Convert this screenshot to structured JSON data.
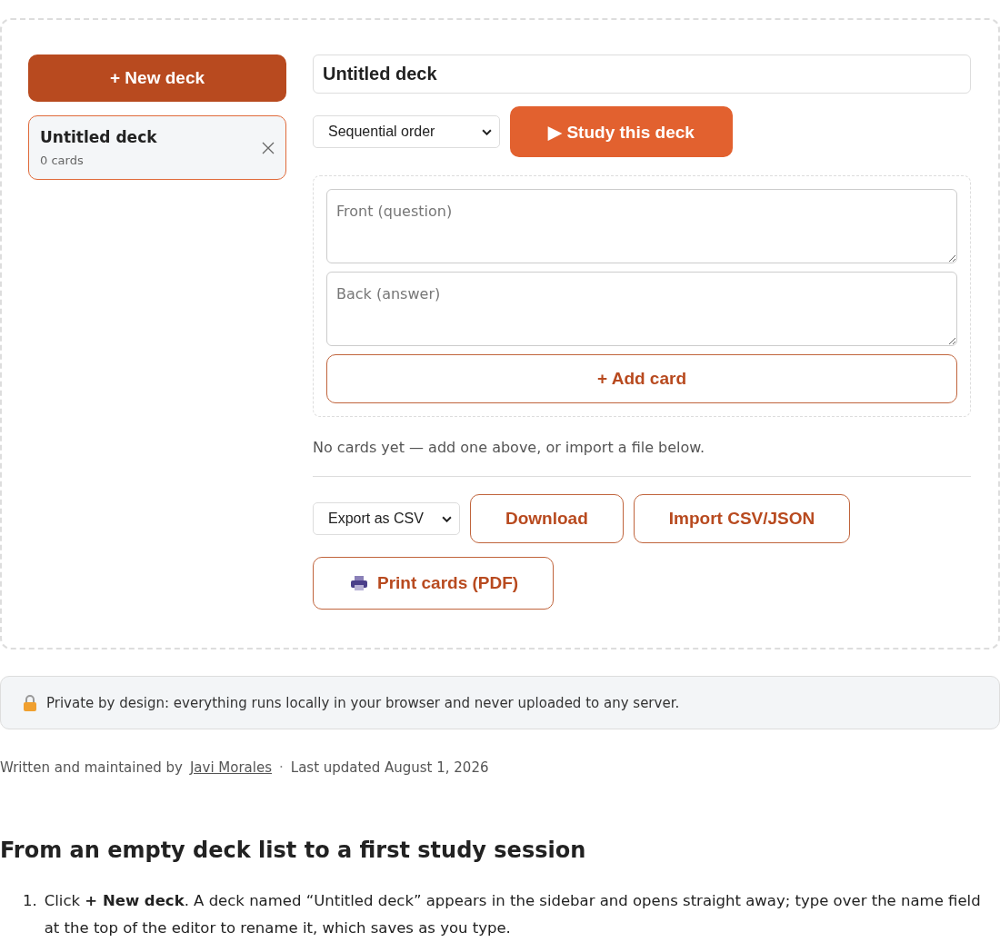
{
  "sidebar": {
    "new_deck_button": "+ New deck",
    "decks": [
      {
        "name": "Untitled deck",
        "count": "0 cards",
        "selected": true
      }
    ]
  },
  "editor": {
    "deck_name": "Untitled deck",
    "order_select": "Sequential order",
    "study_button": "▶ Study this deck",
    "front_placeholder": "Front (question)",
    "back_placeholder": "Back (answer)",
    "add_card_button": "+ Add card",
    "empty_message": "No cards yet — add one above, or import a file below.",
    "export_select": "Export as CSV",
    "download_button": "Download",
    "import_button": "Import CSV/JSON",
    "print_button": "Print cards (PDF)"
  },
  "privacy_notice": "Private by design: everything runs locally in your browser and never uploaded to any server.",
  "byline": {
    "prefix": "Written and maintained by",
    "author": "Javi Morales",
    "separator": "·",
    "updated": "Last updated August 1, 2026"
  },
  "article": {
    "heading": "From an empty deck list to a first study session",
    "steps": [
      {
        "number": "1.",
        "text": "Click **+ New deck**. A deck named “Untitled deck” appears in the sidebar and opens straight away; type over the name field at the top of the editor to rename it, which saves as you type."
      }
    ]
  }
}
